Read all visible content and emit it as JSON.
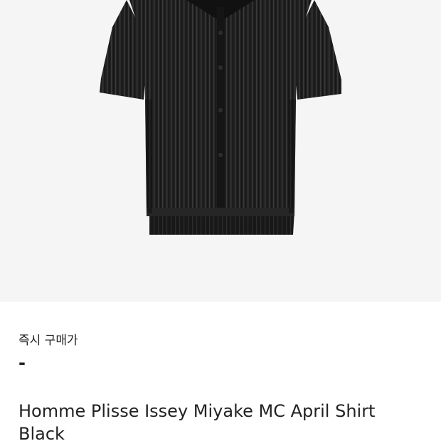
{
  "product": {
    "image_alt": "Homme Plisse Issey Miyake MC April Shirt Black",
    "image_subject": "black-pleated-short-sleeve-shirt",
    "background_color": "#f5f5f5",
    "garment_color": "#1d1d1d"
  },
  "price": {
    "label": "즉시 구매가",
    "value": "-"
  },
  "title": "Homme Plisse Issey Miyake MC April Shirt Black"
}
